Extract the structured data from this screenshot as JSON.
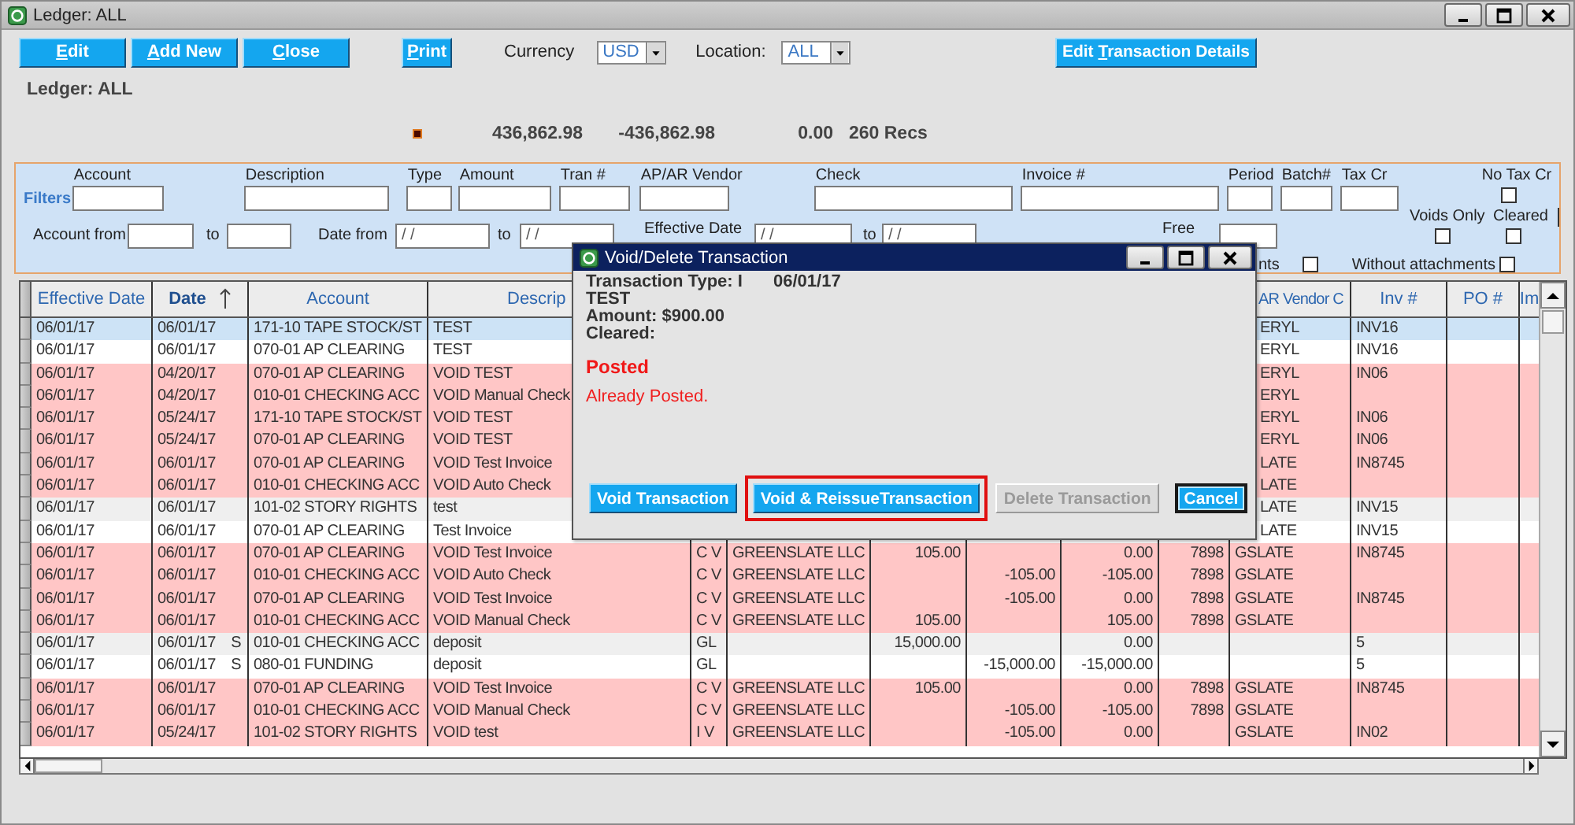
{
  "window": {
    "title": "Ledger: ALL"
  },
  "toolbar": {
    "buttons": [
      {
        "key": "E",
        "after": "dit"
      },
      {
        "key": "A",
        "after": "dd New"
      },
      {
        "key": "C",
        "after": "lose"
      },
      {
        "key": "P",
        "after": "rint"
      }
    ],
    "currency": {
      "label": "Currency",
      "value": "USD"
    },
    "location": {
      "label": "Location:",
      "value": "ALL"
    },
    "details_button": {
      "before": "Edit ",
      "key": "T",
      "after": "ransaction Details"
    }
  },
  "heading": "Ledger: ALL",
  "totals": {
    "debit": "436,862.98",
    "credit": "-436,862.98",
    "balance": "0.00",
    "count": "260 Recs"
  },
  "filters": {
    "title": "Filters",
    "fields": [
      {
        "label": "Account"
      },
      {
        "label": "Description"
      },
      {
        "label": "Type"
      },
      {
        "label": "Amount"
      },
      {
        "label": "Tran #"
      },
      {
        "label": "AP/AR Vendor"
      },
      {
        "label": "Check"
      },
      {
        "label": "Invoice #"
      },
      {
        "label": "Period"
      },
      {
        "label": "Batch#"
      },
      {
        "label": "Tax Cr"
      }
    ],
    "no_tax_cr": {
      "label": "No Tax Cr",
      "checked": false
    },
    "voids_only": {
      "label": "Voids Only",
      "checked": false
    },
    "cleared": {
      "label": "Cleared",
      "checked": false
    },
    "account_range": {
      "label": "Account from",
      "to_label": "to"
    },
    "date_range": {
      "label": "Date from",
      "from": "/ /",
      "to_label": "to",
      "to": "/ /"
    },
    "effective_range": {
      "label": "Effective Date",
      "from": "/ /",
      "to_label": "to",
      "to": "/ /"
    },
    "free": {
      "label": "Free"
    },
    "attachments": {
      "label": "nts",
      "checked": false
    },
    "without_attachments": {
      "label": "Without attachments",
      "checked": false
    }
  },
  "table": {
    "columns": [
      {
        "label": "Effective Date",
        "sorted": false
      },
      {
        "label": "Date",
        "sorted": true
      },
      {
        "label": "Account",
        "sorted": false
      },
      {
        "label": "Descrip",
        "sorted": false
      },
      {
        "label": "AR Vendor C",
        "sorted": false
      },
      {
        "label": "Inv #",
        "sorted": false
      },
      {
        "label": "PO #",
        "sorted": false
      },
      {
        "label": "Im",
        "sorted": false
      }
    ],
    "rows": [
      {
        "effective": "06/01/17",
        "date": "06/01/17",
        "account": "171-10 TAPE STOCK/ST",
        "description": "TEST",
        "vendor_code": "ERYL",
        "inv": "INV16",
        "covered": true,
        "selected": true,
        "voided": false
      },
      {
        "effective": "06/01/17",
        "date": "06/01/17",
        "account": "070-01 AP CLEARING",
        "description": "TEST",
        "vendor_code": "ERYL",
        "inv": "INV16",
        "covered": true,
        "selected": false,
        "voided": false
      },
      {
        "effective": "06/01/17",
        "date": "04/20/17",
        "account": "070-01 AP CLEARING",
        "description": "VOID TEST",
        "vendor_code": "ERYL",
        "inv": "IN06",
        "covered": true,
        "selected": false,
        "voided": true
      },
      {
        "effective": "06/01/17",
        "date": "04/20/17",
        "account": "010-01 CHECKING ACC",
        "description": "VOID Manual Check",
        "vendor_code": "ERYL",
        "covered": true,
        "selected": false,
        "voided": true
      },
      {
        "effective": "06/01/17",
        "date": "05/24/17",
        "account": "171-10 TAPE STOCK/ST",
        "description": "VOID TEST",
        "vendor_code": "ERYL",
        "inv": "IN06",
        "covered": true,
        "selected": false,
        "voided": true
      },
      {
        "effective": "06/01/17",
        "date": "05/24/17",
        "account": "070-01 AP CLEARING",
        "description": "VOID TEST",
        "vendor_code": "ERYL",
        "inv": "IN06",
        "covered": true,
        "selected": false,
        "voided": true
      },
      {
        "effective": "06/01/17",
        "date": "06/01/17",
        "account": "070-01 AP CLEARING",
        "description": "VOID Test Invoice",
        "vendor_code": "LATE",
        "inv": "IN8745",
        "covered": true,
        "selected": false,
        "voided": true
      },
      {
        "effective": "06/01/17",
        "date": "06/01/17",
        "account": "010-01 CHECKING ACC",
        "description": "VOID Auto Check",
        "vendor_code": "LATE",
        "covered": true,
        "selected": false,
        "voided": true
      },
      {
        "effective": "06/01/17",
        "date": "06/01/17",
        "account": "101-02 STORY RIGHTS",
        "description": "test",
        "vendor_code": "LATE",
        "inv": "INV15",
        "covered": true,
        "selected": false,
        "voided": false
      },
      {
        "effective": "06/01/17",
        "date": "06/01/17",
        "account": "070-01 AP CLEARING",
        "description": "Test Invoice",
        "vendor_code": "LATE",
        "inv": "INV15",
        "covered": true,
        "selected": false,
        "voided": false
      },
      {
        "effective": "06/01/17",
        "date": "06/01/17",
        "account": "070-01 AP CLEARING",
        "description": "VOID Test Invoice",
        "type": "C V",
        "vendor": "GREENSLATE LLC",
        "debit": "105.00",
        "balance": "0.00",
        "check": "7898",
        "vendor_code": "GSLATE",
        "inv": "IN8745",
        "covered": false,
        "selected": false,
        "voided": true
      },
      {
        "effective": "06/01/17",
        "date": "06/01/17",
        "account": "010-01 CHECKING ACC",
        "description": "VOID Auto Check",
        "type": "C V",
        "vendor": "GREENSLATE LLC",
        "credit": "-105.00",
        "balance": "-105.00",
        "check": "7898",
        "vendor_code": "GSLATE",
        "covered": false,
        "selected": false,
        "voided": true
      },
      {
        "effective": "06/01/17",
        "date": "06/01/17",
        "account": "070-01 AP CLEARING",
        "description": "VOID Test Invoice",
        "type": "C V",
        "vendor": "GREENSLATE LLC",
        "credit": "-105.00",
        "balance": "0.00",
        "check": "7898",
        "vendor_code": "GSLATE",
        "inv": "IN8745",
        "covered": false,
        "selected": false,
        "voided": true
      },
      {
        "effective": "06/01/17",
        "date": "06/01/17",
        "account": "010-01 CHECKING ACC",
        "description": "VOID Manual Check",
        "type": "C V",
        "vendor": "GREENSLATE LLC",
        "debit": "105.00",
        "balance": "105.00",
        "check": "7898",
        "vendor_code": "GSLATE",
        "covered": false,
        "selected": false,
        "voided": true
      },
      {
        "effective": "06/01/17",
        "date": "06/01/17",
        "date_flag": "S",
        "account": "010-01 CHECKING ACC",
        "description": "deposit",
        "type": "GL",
        "debit": "15,000.00",
        "balance": "0.00",
        "inv": "5",
        "covered": false,
        "selected": false,
        "voided": false
      },
      {
        "effective": "06/01/17",
        "date": "06/01/17",
        "date_flag": "S",
        "account": "080-01 FUNDING",
        "description": "deposit",
        "type": "GL",
        "credit": "-15,000.00",
        "balance": "-15,000.00",
        "inv": "5",
        "covered": false,
        "selected": false,
        "voided": false
      },
      {
        "effective": "06/01/17",
        "date": "06/01/17",
        "account": "070-01 AP CLEARING",
        "description": "VOID Test Invoice",
        "type": "C V",
        "vendor": "GREENSLATE LLC",
        "debit": "105.00",
        "balance": "0.00",
        "check": "7898",
        "vendor_code": "GSLATE",
        "inv": "IN8745",
        "covered": false,
        "selected": false,
        "voided": true
      },
      {
        "effective": "06/01/17",
        "date": "06/01/17",
        "account": "010-01 CHECKING ACC",
        "description": "VOID Manual Check",
        "type": "C V",
        "vendor": "GREENSLATE LLC",
        "credit": "-105.00",
        "balance": "-105.00",
        "check": "7898",
        "vendor_code": "GSLATE",
        "covered": false,
        "selected": false,
        "voided": true
      },
      {
        "effective": "06/01/17",
        "date": "05/24/17",
        "account": "101-02 STORY RIGHTS",
        "description": "VOID test",
        "type": "I V",
        "vendor": "GREENSLATE LLC",
        "credit": "-105.00",
        "balance": "0.00",
        "vendor_code": "GSLATE",
        "inv": "IN02",
        "covered": false,
        "selected": false,
        "voided": true
      }
    ]
  },
  "dialog": {
    "title": "Void/Delete Transaction",
    "type_line": "Transaction Type: I",
    "date": "06/01/17",
    "description": "TEST",
    "amount": "Amount: $900.00",
    "cleared": "Cleared:",
    "status": "Posted",
    "message": "Already Posted.",
    "buttons": [
      {
        "label": "Void Transaction",
        "disabled": false,
        "highlighted": false,
        "focused": false
      },
      {
        "label": "Void & ReissueTransaction",
        "disabled": false,
        "highlighted": true,
        "focused": false
      },
      {
        "label": "Delete Transaction",
        "disabled": true,
        "highlighted": false,
        "focused": false
      },
      {
        "label": "Cancel",
        "disabled": false,
        "highlighted": false,
        "focused": true
      }
    ]
  }
}
